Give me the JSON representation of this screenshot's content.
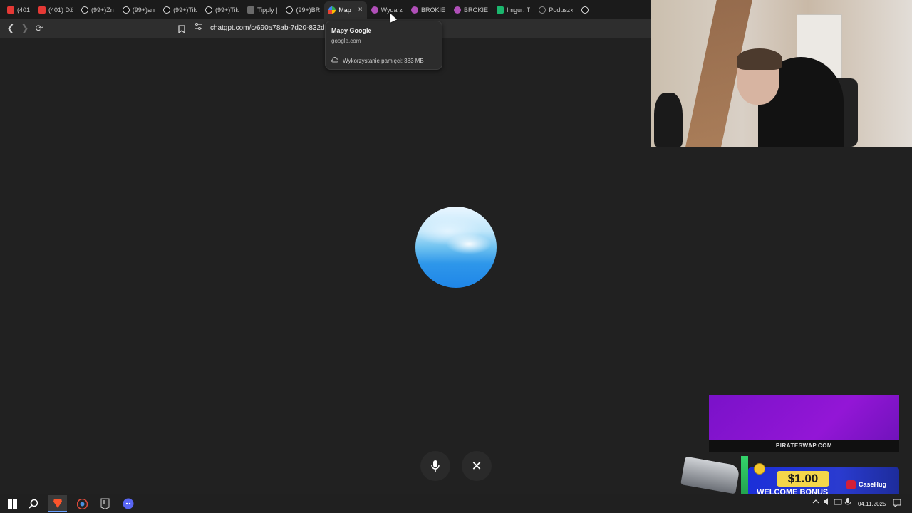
{
  "browser": {
    "tabs": [
      {
        "label": "(401",
        "icon": "youtube-icon"
      },
      {
        "label": "(401) Dž",
        "icon": "youtube-icon"
      },
      {
        "label": "(99+)Zn",
        "icon": "tiktok-icon"
      },
      {
        "label": "(99+)an",
        "icon": "tiktok-icon"
      },
      {
        "label": "(99+)Tik",
        "icon": "tiktok-icon"
      },
      {
        "label": "(99+)Tik",
        "icon": "tiktok-icon"
      },
      {
        "label": "Tipply |",
        "icon": "tipply-icon"
      },
      {
        "label": "(99+)BR",
        "icon": "tiktok-icon"
      },
      {
        "label": "Map",
        "icon": "google-maps-icon",
        "active": true
      },
      {
        "label": "Wydarz",
        "icon": "messenger-icon"
      },
      {
        "label": "BROKIE",
        "icon": "messenger-icon"
      },
      {
        "label": "BROKIE",
        "icon": "messenger-icon"
      },
      {
        "label": "Imgur: T",
        "icon": "imgur-icon"
      },
      {
        "label": "Poduszk",
        "icon": "pillow-icon"
      },
      {
        "label": "",
        "icon": "tiktok-icon"
      }
    ],
    "tab_close_glyph": "×",
    "url": "chatgpt.com/c/690a78ab-7d20-832d-9",
    "tooltip": {
      "title": "Mapy Google",
      "host": "google.com",
      "memory": "Wykorzystanie pamięci: 383 MB"
    }
  },
  "voice": {
    "mic_glyph": "🎙",
    "close_glyph": "✕"
  },
  "ad": {
    "site": "PIRATESWAP.COM",
    "amount": "$1.00",
    "text": "WELCOME BONUS",
    "brand": "CaseHug"
  },
  "taskbar": {
    "date": "04.11.2025"
  },
  "colors": {
    "background": "#212121",
    "tabstrip": "#1b1b1b",
    "toolbar": "#2e2e2e",
    "accent": "#68a0ff"
  }
}
